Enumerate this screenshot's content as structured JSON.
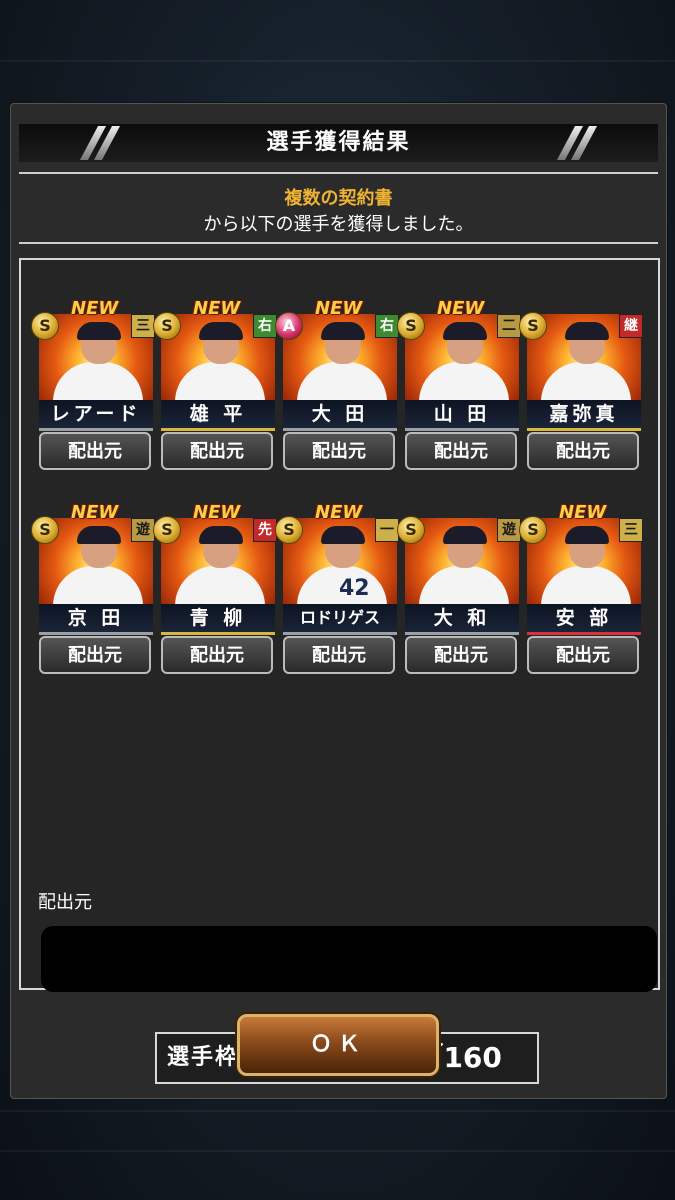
{
  "dialog": {
    "title": "選手獲得結果",
    "source_name": "複数の契約書",
    "message": "から以下の選手を獲得しました。",
    "source_label": "配出元",
    "source_value": "",
    "slot_label": "選手枠：",
    "slot_value": "127／160",
    "ok_label": "ＯＫ"
  },
  "cards": [
    {
      "name": "レアード",
      "rank": "S",
      "position": "三",
      "new": "NEW",
      "button": "配出元",
      "number": ""
    },
    {
      "name": "雄 平",
      "rank": "S",
      "position": "右",
      "new": "NEW",
      "button": "配出元",
      "number": ""
    },
    {
      "name": "大 田",
      "rank": "A",
      "position": "右",
      "new": "NEW",
      "button": "配出元",
      "number": ""
    },
    {
      "name": "山 田",
      "rank": "S",
      "position": "二",
      "new": "NEW",
      "button": "配出元",
      "number": ""
    },
    {
      "name": "嘉弥真",
      "rank": "S",
      "position": "継",
      "new": "",
      "button": "配出元",
      "number": ""
    },
    {
      "name": "京 田",
      "rank": "S",
      "position": "遊",
      "new": "NEW",
      "button": "配出元",
      "number": ""
    },
    {
      "name": "青 柳",
      "rank": "S",
      "position": "先",
      "new": "NEW",
      "button": "配出元",
      "number": ""
    },
    {
      "name": "ロドリゲス",
      "rank": "S",
      "position": "一",
      "new": "NEW",
      "button": "配出元",
      "number": "42"
    },
    {
      "name": "大 和",
      "rank": "S",
      "position": "遊",
      "new": "",
      "button": "配出元",
      "number": ""
    },
    {
      "name": "安 部",
      "rank": "S",
      "position": "三",
      "new": "NEW",
      "button": "配出元",
      "number": ""
    }
  ],
  "colors": {
    "accent_orange": "#f0b332",
    "panel_bg": "#2b2b2b",
    "ok_button": "#8a4a1c"
  }
}
